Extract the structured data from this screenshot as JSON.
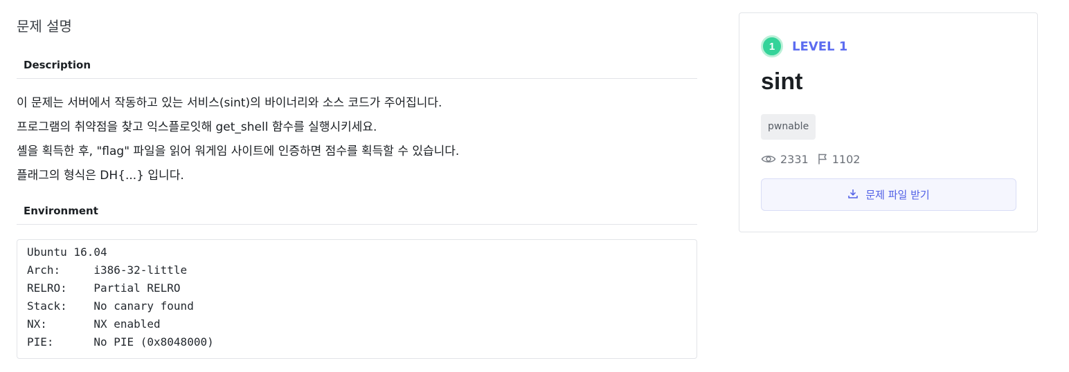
{
  "page": {
    "title": "문제 설명"
  },
  "description": {
    "heading": "Description",
    "lines": [
      "이 문제는 서버에서 작동하고 있는 서비스(sint)의 바이너리와 소스 코드가 주어집니다.",
      "프로그램의 취약점을 찾고 익스플로잇해 get_shell 함수를 실행시키세요.",
      "셸을 획득한 후, \"flag\" 파일을 읽어 워게임 사이트에 인증하면 점수를 획득할 수 있습니다.",
      "플래그의 형식은 DH{...} 입니다."
    ]
  },
  "environment": {
    "heading": "Environment",
    "lines": [
      "Ubuntu 16.04",
      "Arch:     i386-32-little",
      "RELRO:    Partial RELRO",
      "Stack:    No canary found",
      "NX:       NX enabled",
      "PIE:      No PIE (0x8048000)"
    ]
  },
  "card": {
    "level_number": "1",
    "level_label": "LEVEL 1",
    "title": "sint",
    "tag": "pwnable",
    "views": "2331",
    "solves": "1102",
    "download_label": "문제 파일 받기",
    "icons": [
      "eye-icon",
      "flag-icon",
      "download-icon"
    ],
    "colors": {
      "accent": "#5c6cf0",
      "level_badge": "#34d399",
      "button_bg": "#f5f6fe"
    }
  }
}
